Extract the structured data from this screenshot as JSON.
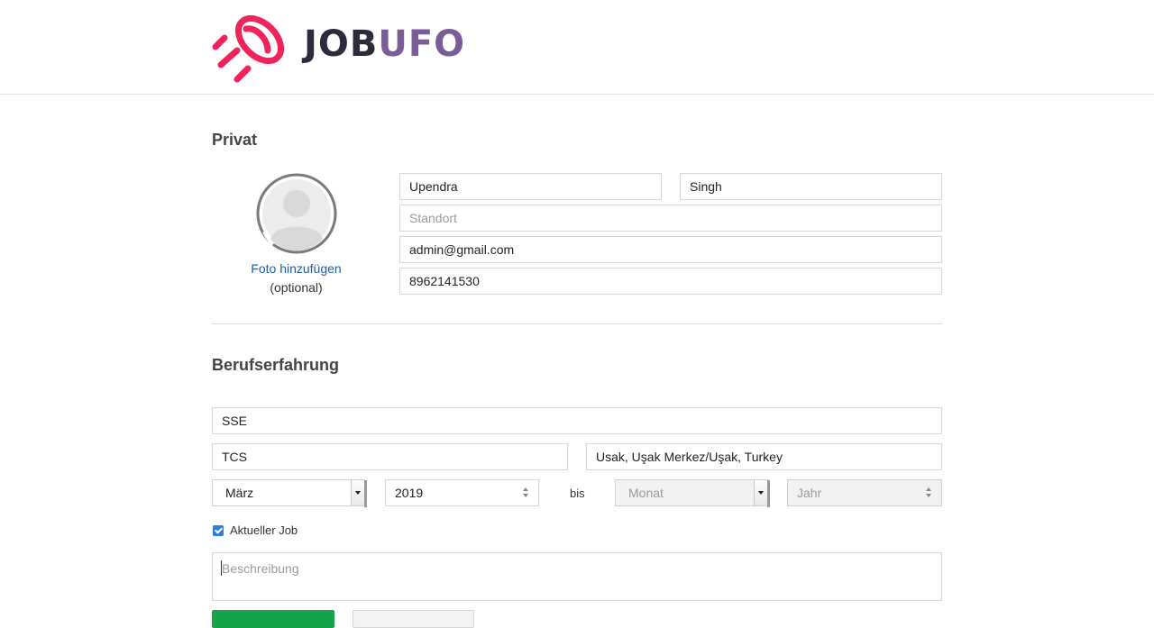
{
  "brand": {
    "name_part1": "JOB",
    "name_part2": "UFO",
    "colors": {
      "mark": "#f0245a",
      "job": "#2d2a3b",
      "ufo": "#7a5c99"
    }
  },
  "private": {
    "title": "Privat",
    "photo_link": "Foto hinzufügen",
    "photo_optional": "(optional)",
    "first_name": "Upendra",
    "last_name": "Singh",
    "location_placeholder": "Standort",
    "email": "admin@gmail.com",
    "phone": "8962141530"
  },
  "experience": {
    "title": "Berufserfahrung",
    "position": "SSE",
    "company": "TCS",
    "location": "Usak, Uşak Merkez/Uşak, Turkey",
    "start_month": "März",
    "start_year": "2019",
    "separator": "bis",
    "end_month_placeholder": "Monat",
    "end_year_placeholder": "Jahr",
    "current_job_label": "Aktueller Job",
    "current_job_checked": true,
    "description_placeholder": "Beschreibung"
  },
  "icons": {
    "logo": "ufo-rocket-icon",
    "avatar": "user-avatar-icon",
    "dropdown": "chevron-down-icon",
    "stepper": "stepper-icon",
    "checkbox": "checkmark-icon"
  },
  "colors": {
    "link": "#1a5fa8",
    "primary_button": "#17a34a",
    "checkbox": "#2f7de1"
  }
}
